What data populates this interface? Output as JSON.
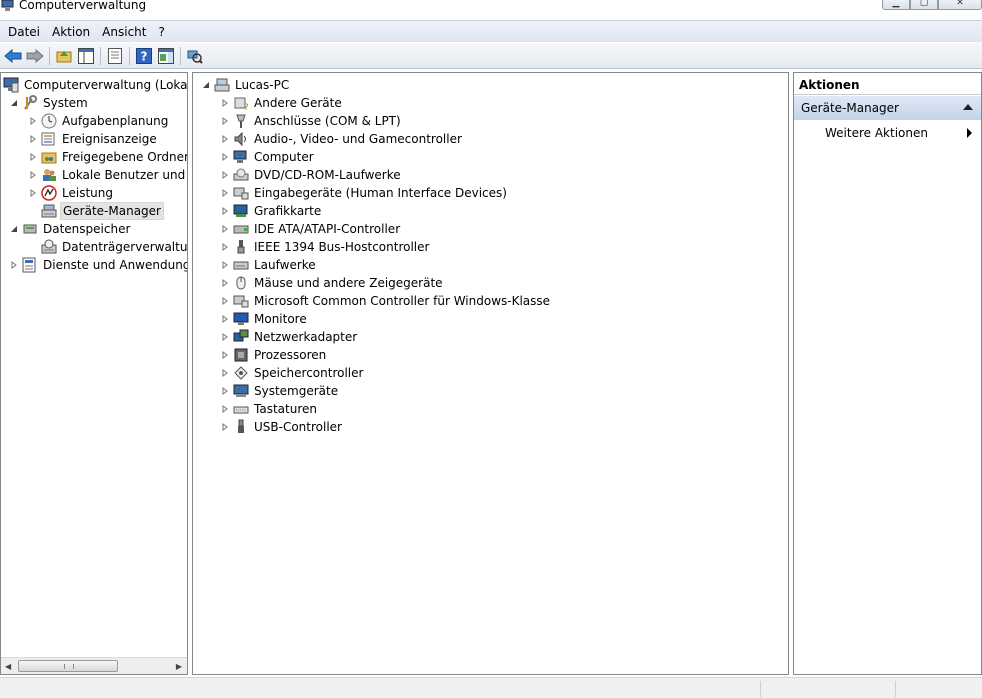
{
  "window": {
    "title": "Computerverwaltung",
    "minimize_icon": "minimize-icon",
    "maximize_icon": "maximize-icon",
    "close_icon": "close-icon"
  },
  "menubar": {
    "items": [
      "Datei",
      "Aktion",
      "Ansicht",
      "?"
    ]
  },
  "toolbar": {
    "buttons": [
      "back-arrow-icon",
      "forward-arrow-icon",
      "up-folder-icon",
      "show-hide-tree-icon",
      "properties-icon",
      "help-icon",
      "show-hide-action-icon",
      "scan-hardware-icon"
    ]
  },
  "tree": {
    "items": [
      {
        "label": "Computerverwaltung (Lokal)",
        "icon": "computer-management-icon",
        "arrow": ""
      },
      {
        "label": "System",
        "icon": "system-tools-icon",
        "arrow": "expanded"
      },
      {
        "label": "Aufgabenplanung",
        "icon": "clock-icon",
        "arrow": "collapsed"
      },
      {
        "label": "Ereignisanzeige",
        "icon": "event-viewer-icon",
        "arrow": "collapsed"
      },
      {
        "label": "Freigegebene Ordner",
        "icon": "shared-folder-icon",
        "arrow": "collapsed"
      },
      {
        "label": "Lokale Benutzer und Gruppen",
        "icon": "users-icon",
        "arrow": "collapsed"
      },
      {
        "label": "Leistung",
        "icon": "performance-icon",
        "arrow": "collapsed"
      },
      {
        "label": "Geräte-Manager",
        "icon": "device-manager-icon",
        "arrow": ""
      },
      {
        "label": "Datenspeicher",
        "icon": "storage-icon",
        "arrow": "expanded"
      },
      {
        "label": "Datenträgerverwaltung",
        "icon": "disk-management-icon",
        "arrow": ""
      },
      {
        "label": "Dienste und Anwendungen",
        "icon": "services-icon",
        "arrow": "collapsed"
      }
    ]
  },
  "devices": {
    "root": "Lucas-PC",
    "items": [
      {
        "label": "Andere Geräte",
        "icon": "unknown-device-icon"
      },
      {
        "label": "Anschlüsse (COM & LPT)",
        "icon": "port-icon"
      },
      {
        "label": "Audio-, Video- und Gamecontroller",
        "icon": "speaker-icon"
      },
      {
        "label": "Computer",
        "icon": "computer-icon"
      },
      {
        "label": "DVD/CD-ROM-Laufwerke",
        "icon": "dvd-drive-icon"
      },
      {
        "label": "Eingabegeräte (Human Interface Devices)",
        "icon": "hid-icon"
      },
      {
        "label": "Grafikkarte",
        "icon": "display-adapter-icon"
      },
      {
        "label": "IDE ATA/ATAPI-Controller",
        "icon": "ide-controller-icon"
      },
      {
        "label": "IEEE 1394 Bus-Hostcontroller",
        "icon": "firewire-icon"
      },
      {
        "label": "Laufwerke",
        "icon": "drive-icon"
      },
      {
        "label": "Mäuse und andere Zeigegeräte",
        "icon": "mouse-icon"
      },
      {
        "label": "Microsoft Common Controller für Windows-Klasse",
        "icon": "hid-icon"
      },
      {
        "label": "Monitore",
        "icon": "monitor-icon"
      },
      {
        "label": "Netzwerkadapter",
        "icon": "network-adapter-icon"
      },
      {
        "label": "Prozessoren",
        "icon": "processor-icon"
      },
      {
        "label": "Speichercontroller",
        "icon": "storage-controller-icon"
      },
      {
        "label": "Systemgeräte",
        "icon": "system-device-icon"
      },
      {
        "label": "Tastaturen",
        "icon": "keyboard-icon"
      },
      {
        "label": "USB-Controller",
        "icon": "usb-icon"
      }
    ]
  },
  "actions": {
    "header": "Aktionen",
    "section": "Geräte-Manager",
    "more": "Weitere Aktionen"
  },
  "colors": {
    "menubar": "#dfe6f0",
    "action_section": "#c3d4ea",
    "selection": "#e4e4e4"
  }
}
